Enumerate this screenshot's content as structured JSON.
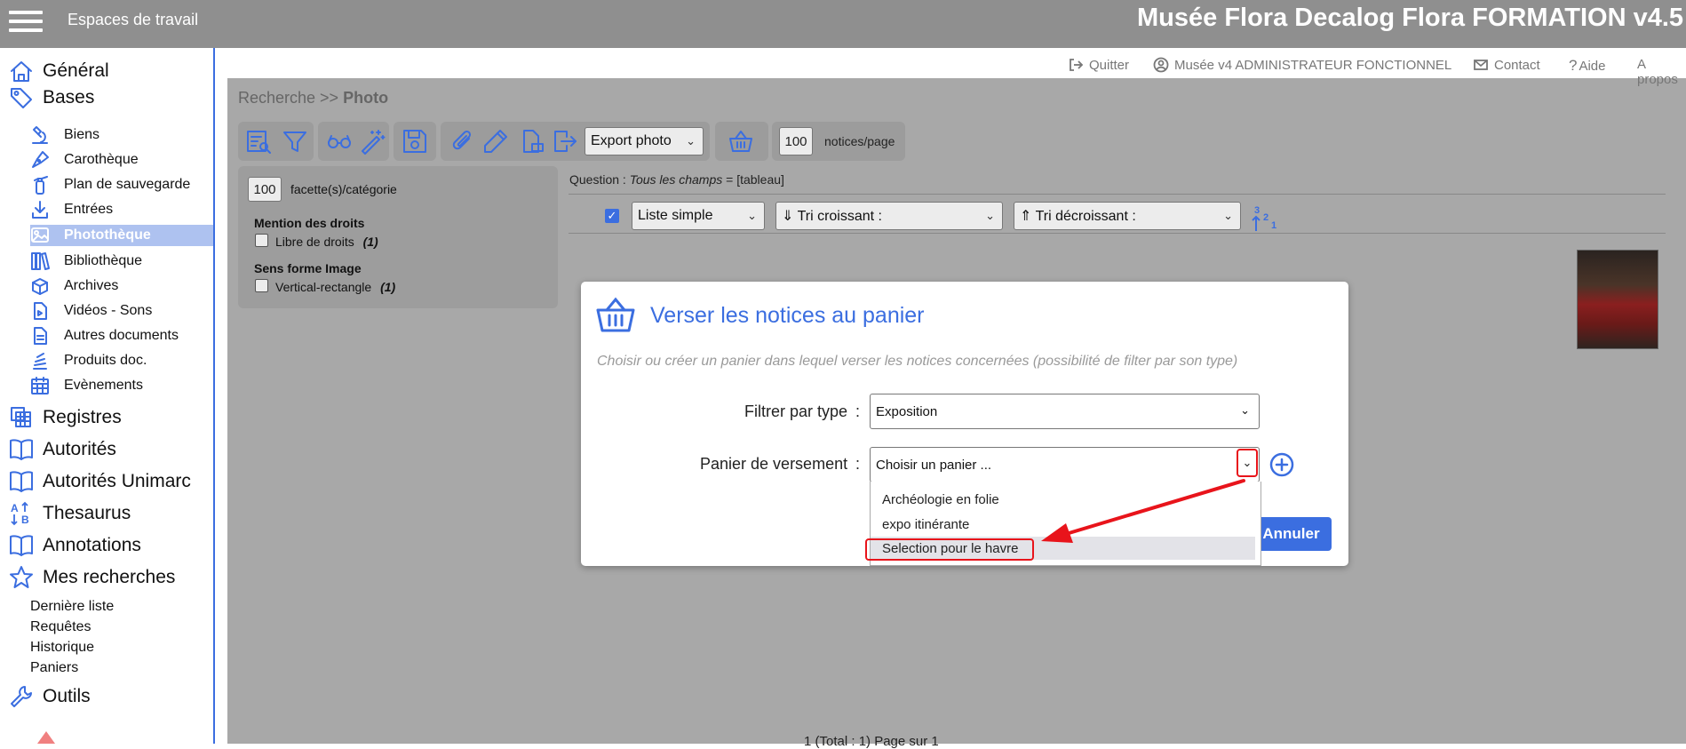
{
  "header": {
    "workspaces_label": "Espaces de travail",
    "app_title": "Musée Flora Decalog Flora FORMATION v4.5"
  },
  "util": {
    "quit": "Quitter",
    "user": "Musée v4 ADMINISTRATEUR FONCTIONNEL",
    "contact": "Contact",
    "help": "Aide",
    "about": "A propos"
  },
  "sidebar": {
    "top_items": [
      {
        "label": "Général",
        "icon": "home-icon"
      },
      {
        "label": "Bases",
        "icon": "tag-icon"
      },
      {
        "label": "Registres",
        "icon": "copy-icon"
      },
      {
        "label": "Autorités",
        "icon": "book-icon"
      },
      {
        "label": "Autorités Unimarc",
        "icon": "book-icon"
      },
      {
        "label": "Thesaurus",
        "icon": "sort-alpha-icon"
      },
      {
        "label": "Annotations",
        "icon": "book-icon"
      },
      {
        "label": "Mes recherches",
        "icon": "star-icon"
      },
      {
        "label": "Outils",
        "icon": "wrench-icon"
      }
    ],
    "bases_items": [
      {
        "label": "Biens",
        "icon": "microscope-icon"
      },
      {
        "label": "Carothèque",
        "icon": "pen-nib-icon"
      },
      {
        "label": "Plan de sauvegarde",
        "icon": "extinguisher-icon"
      },
      {
        "label": "Entrées",
        "icon": "download-icon"
      },
      {
        "label": "Photothèque",
        "icon": "image-icon",
        "active": true
      },
      {
        "label": "Bibliothèque",
        "icon": "books-icon"
      },
      {
        "label": "Archives",
        "icon": "archive-box-icon"
      },
      {
        "label": "Vidéos - Sons",
        "icon": "video-file-icon"
      },
      {
        "label": "Autres documents",
        "icon": "document-icon"
      },
      {
        "label": "Produits doc.",
        "icon": "stack-icon"
      },
      {
        "label": "Evènements",
        "icon": "calendar-icon"
      }
    ],
    "search_items": [
      "Dernière liste",
      "Requêtes",
      "Historique",
      "Paniers"
    ]
  },
  "breadcrumb": {
    "prefix": "Recherche >> ",
    "current": "Photo"
  },
  "toolbar": {
    "export_select": "Export photo",
    "per_page_value": "100",
    "per_page_label": "notices/page"
  },
  "facets": {
    "count_value": "100",
    "count_label": "facette(s)/catégorie",
    "group1_title": "Mention des droits",
    "group1_item": "Libre de droits",
    "group1_count": "(1)",
    "group2_title": "Sens forme Image",
    "group2_item": "Vertical-rectangle",
    "group2_count": "(1)"
  },
  "question": {
    "prefix": "Question : ",
    "value": "Tous les champs",
    "suffix": " = [tableau]"
  },
  "list_controls": {
    "view_select": "Liste simple",
    "sort_asc": "⇓ Tri croissant :",
    "sort_desc": "⇑ Tri décroissant :"
  },
  "modal": {
    "title": "Verser les notices au panier",
    "description": "Choisir ou créer un panier dans lequel verser les notices concernées (possibilité de filter par son type)",
    "filter_label": "Filtrer par type",
    "filter_value": "Exposition",
    "basket_label": "Panier de versement",
    "basket_placeholder": "Choisir un panier ...",
    "colon": ":",
    "options": [
      "Archéologie en folie",
      "expo itinérante",
      "Selection pour le havre"
    ],
    "cancel_label": "Annuler"
  },
  "pager": {
    "text": "1   (Total : 1)      Page        sur   1"
  },
  "colors": {
    "accent": "#3b6ee0",
    "annotation_red": "#e8141b",
    "header_grey": "#8f8f8f",
    "overlay_grey": "#a8a8a8"
  }
}
